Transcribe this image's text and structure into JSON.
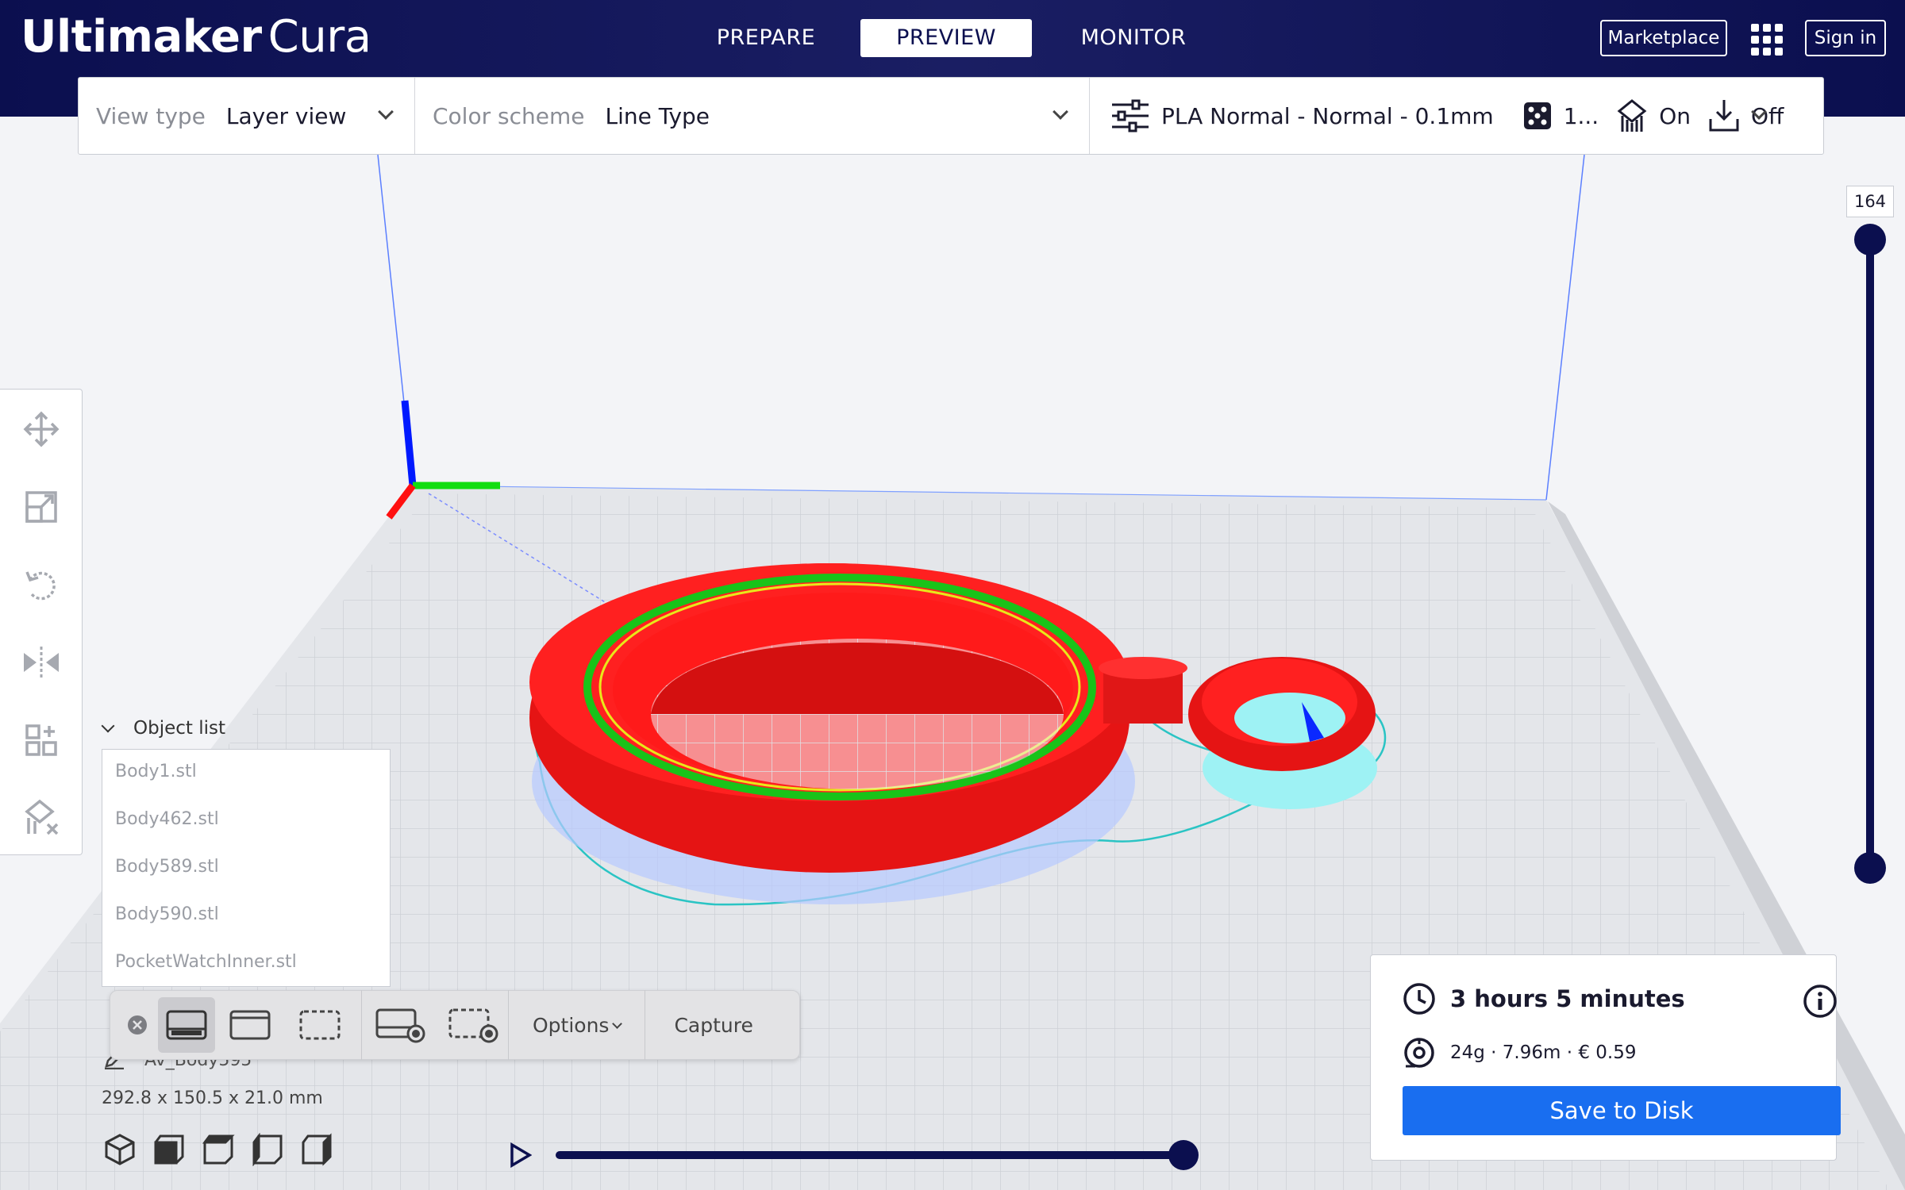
{
  "app": {
    "brand": "Ultimaker",
    "product": "Cura"
  },
  "stages": {
    "prepare": "PREPARE",
    "preview": "PREVIEW",
    "monitor": "MONITOR",
    "active": "PREVIEW"
  },
  "header_buttons": {
    "marketplace": "Marketplace",
    "sign_in": "Sign in"
  },
  "toolbar": {
    "view_type_label": "View type",
    "view_type_value": "Layer view",
    "color_scheme_label": "Color scheme",
    "color_scheme_value": "Line Type",
    "profile": "PLA Normal - Normal - 0.1mm",
    "infill": "1...",
    "support": "On",
    "adhesion": "Off"
  },
  "tool_sidebar": [
    "move-icon",
    "scale-icon",
    "rotate-icon",
    "mirror-icon",
    "per-model-settings-icon",
    "support-blocker-icon"
  ],
  "object_list": {
    "title": "Object list",
    "items": [
      "Body1.stl",
      "Body462.stl",
      "Body589.stl",
      "Body590.stl",
      "PocketWatchInner.stl"
    ]
  },
  "capture_bar": {
    "options": "Options",
    "capture": "Capture"
  },
  "selected_object": {
    "name": "Av_Body595",
    "dimensions": "292.8 x 150.5 x 21.0 mm"
  },
  "layer_slider": {
    "current_layer": "164"
  },
  "estimate": {
    "print_time": "3 hours 5 minutes",
    "material": "24g · 7.96m · € 0.59",
    "save_button": "Save to Disk"
  },
  "colors": {
    "header": "#0b0f4f",
    "accent": "#196ef0",
    "model": "#ff1a1a",
    "support": "#4de8ee"
  }
}
